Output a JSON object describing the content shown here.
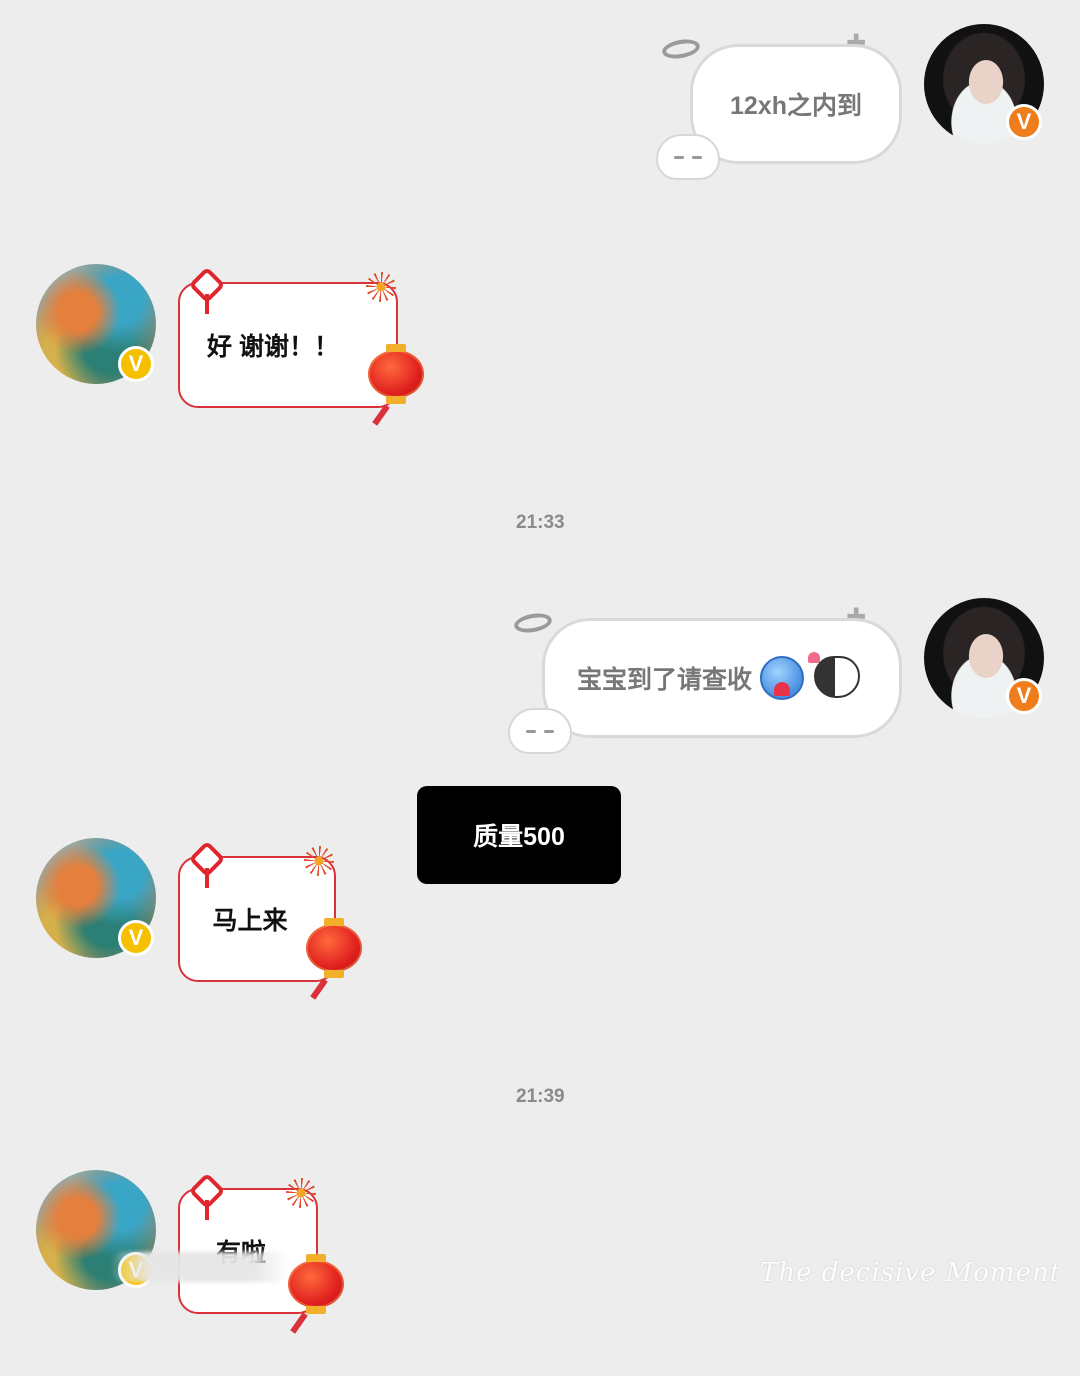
{
  "messages": [
    {
      "side": "out",
      "text": "12xh之内到"
    },
    {
      "side": "in",
      "text": "好 谢谢！！"
    },
    {
      "side": "out",
      "text": "宝宝到了请查收"
    },
    {
      "side": "in",
      "text": "马上来"
    },
    {
      "side": "in",
      "text": "有啦"
    }
  ],
  "timestamps": [
    "21:33",
    "21:39"
  ],
  "overlay": {
    "text": "质量500"
  },
  "badges": {
    "verified": "V"
  },
  "watermark": "The decisive Moment",
  "icons": [
    "halo-icon",
    "cat-face-icon",
    "chinese-knot-icon",
    "firework-icon",
    "lantern-icon",
    "blue-blob-emoji",
    "cat-heart-emoji"
  ],
  "colors": {
    "background": "#ededed",
    "festive_border": "#d9323a",
    "badge_orange": "#f07d1b",
    "badge_yellow": "#f5c000"
  }
}
